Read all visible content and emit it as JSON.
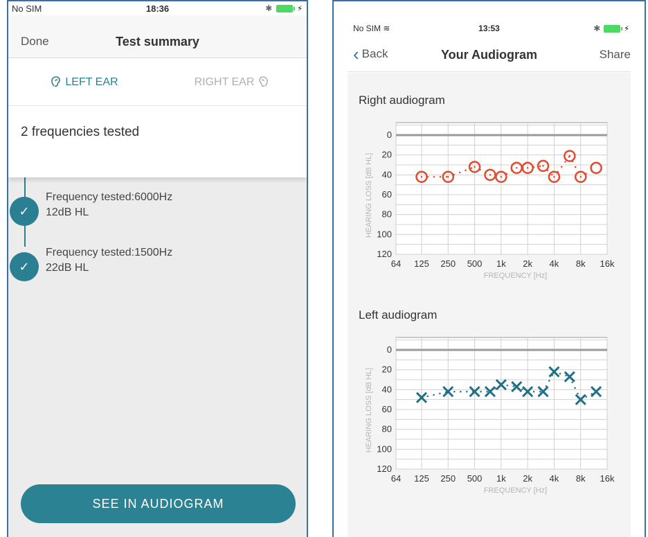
{
  "left_screen": {
    "status": {
      "carrier": "No SIM",
      "time": "18:36",
      "bolt": "⚡"
    },
    "nav": {
      "done": "Done",
      "title": "Test summary"
    },
    "tabs": [
      {
        "label": "LEFT EAR",
        "icon": "ear-icon",
        "active": true
      },
      {
        "label": "RIGHT EAR",
        "icon": "ear-icon",
        "active": false
      }
    ],
    "summary": "2 frequencies tested",
    "results": [
      {
        "line1": "Frequency tested:6000Hz",
        "line2": "12dB HL"
      },
      {
        "line1": "Frequency tested:1500Hz",
        "line2": "22dB HL"
      }
    ],
    "cta": "SEE IN AUDIOGRAM",
    "accent": "#2a8293"
  },
  "right_screen": {
    "status": {
      "carrier": "No SIM",
      "time": "13:53",
      "bolt": "⚡"
    },
    "nav": {
      "back": "Back",
      "title": "Your Audiogram",
      "share": "Share"
    },
    "right_title": "Right audiogram",
    "left_title": "Left audiogram"
  },
  "chart_data": [
    {
      "type": "scatter",
      "title": "Right audiogram",
      "xlabel": "FREQUENCY [Hz]",
      "ylabel": "HEARING LOSS [dB HL]",
      "x_ticks": [
        "64",
        "125",
        "250",
        "500",
        "1k",
        "2k",
        "4k",
        "8k",
        "16k"
      ],
      "y_ticks": [
        "0",
        "20",
        "40",
        "60",
        "80",
        "100",
        "120"
      ],
      "ylim": [
        120,
        0
      ],
      "x_scale": "log",
      "marker": "circle",
      "color": "#e04a2f",
      "x": [
        125,
        250,
        500,
        750,
        1000,
        1500,
        2000,
        3000,
        4000,
        6000,
        8000,
        12000
      ],
      "y": [
        42,
        42,
        32,
        40,
        42,
        33,
        33,
        31,
        42,
        21,
        42,
        33
      ]
    },
    {
      "type": "scatter",
      "title": "Left audiogram",
      "xlabel": "FREQUENCY [Hz]",
      "ylabel": "HEARING LOSS [dB HL]",
      "x_ticks": [
        "64",
        "125",
        "250",
        "500",
        "1k",
        "2k",
        "4k",
        "8k",
        "16k"
      ],
      "y_ticks": [
        "0",
        "20",
        "40",
        "60",
        "80",
        "100",
        "120"
      ],
      "ylim": [
        120,
        0
      ],
      "x_scale": "log",
      "marker": "cross",
      "color": "#1f6f86",
      "x": [
        125,
        250,
        500,
        750,
        1000,
        1500,
        2000,
        3000,
        4000,
        6000,
        8000,
        12000
      ],
      "y": [
        48,
        42,
        42,
        42,
        35,
        37,
        42,
        42,
        22,
        27,
        50,
        42
      ]
    }
  ]
}
